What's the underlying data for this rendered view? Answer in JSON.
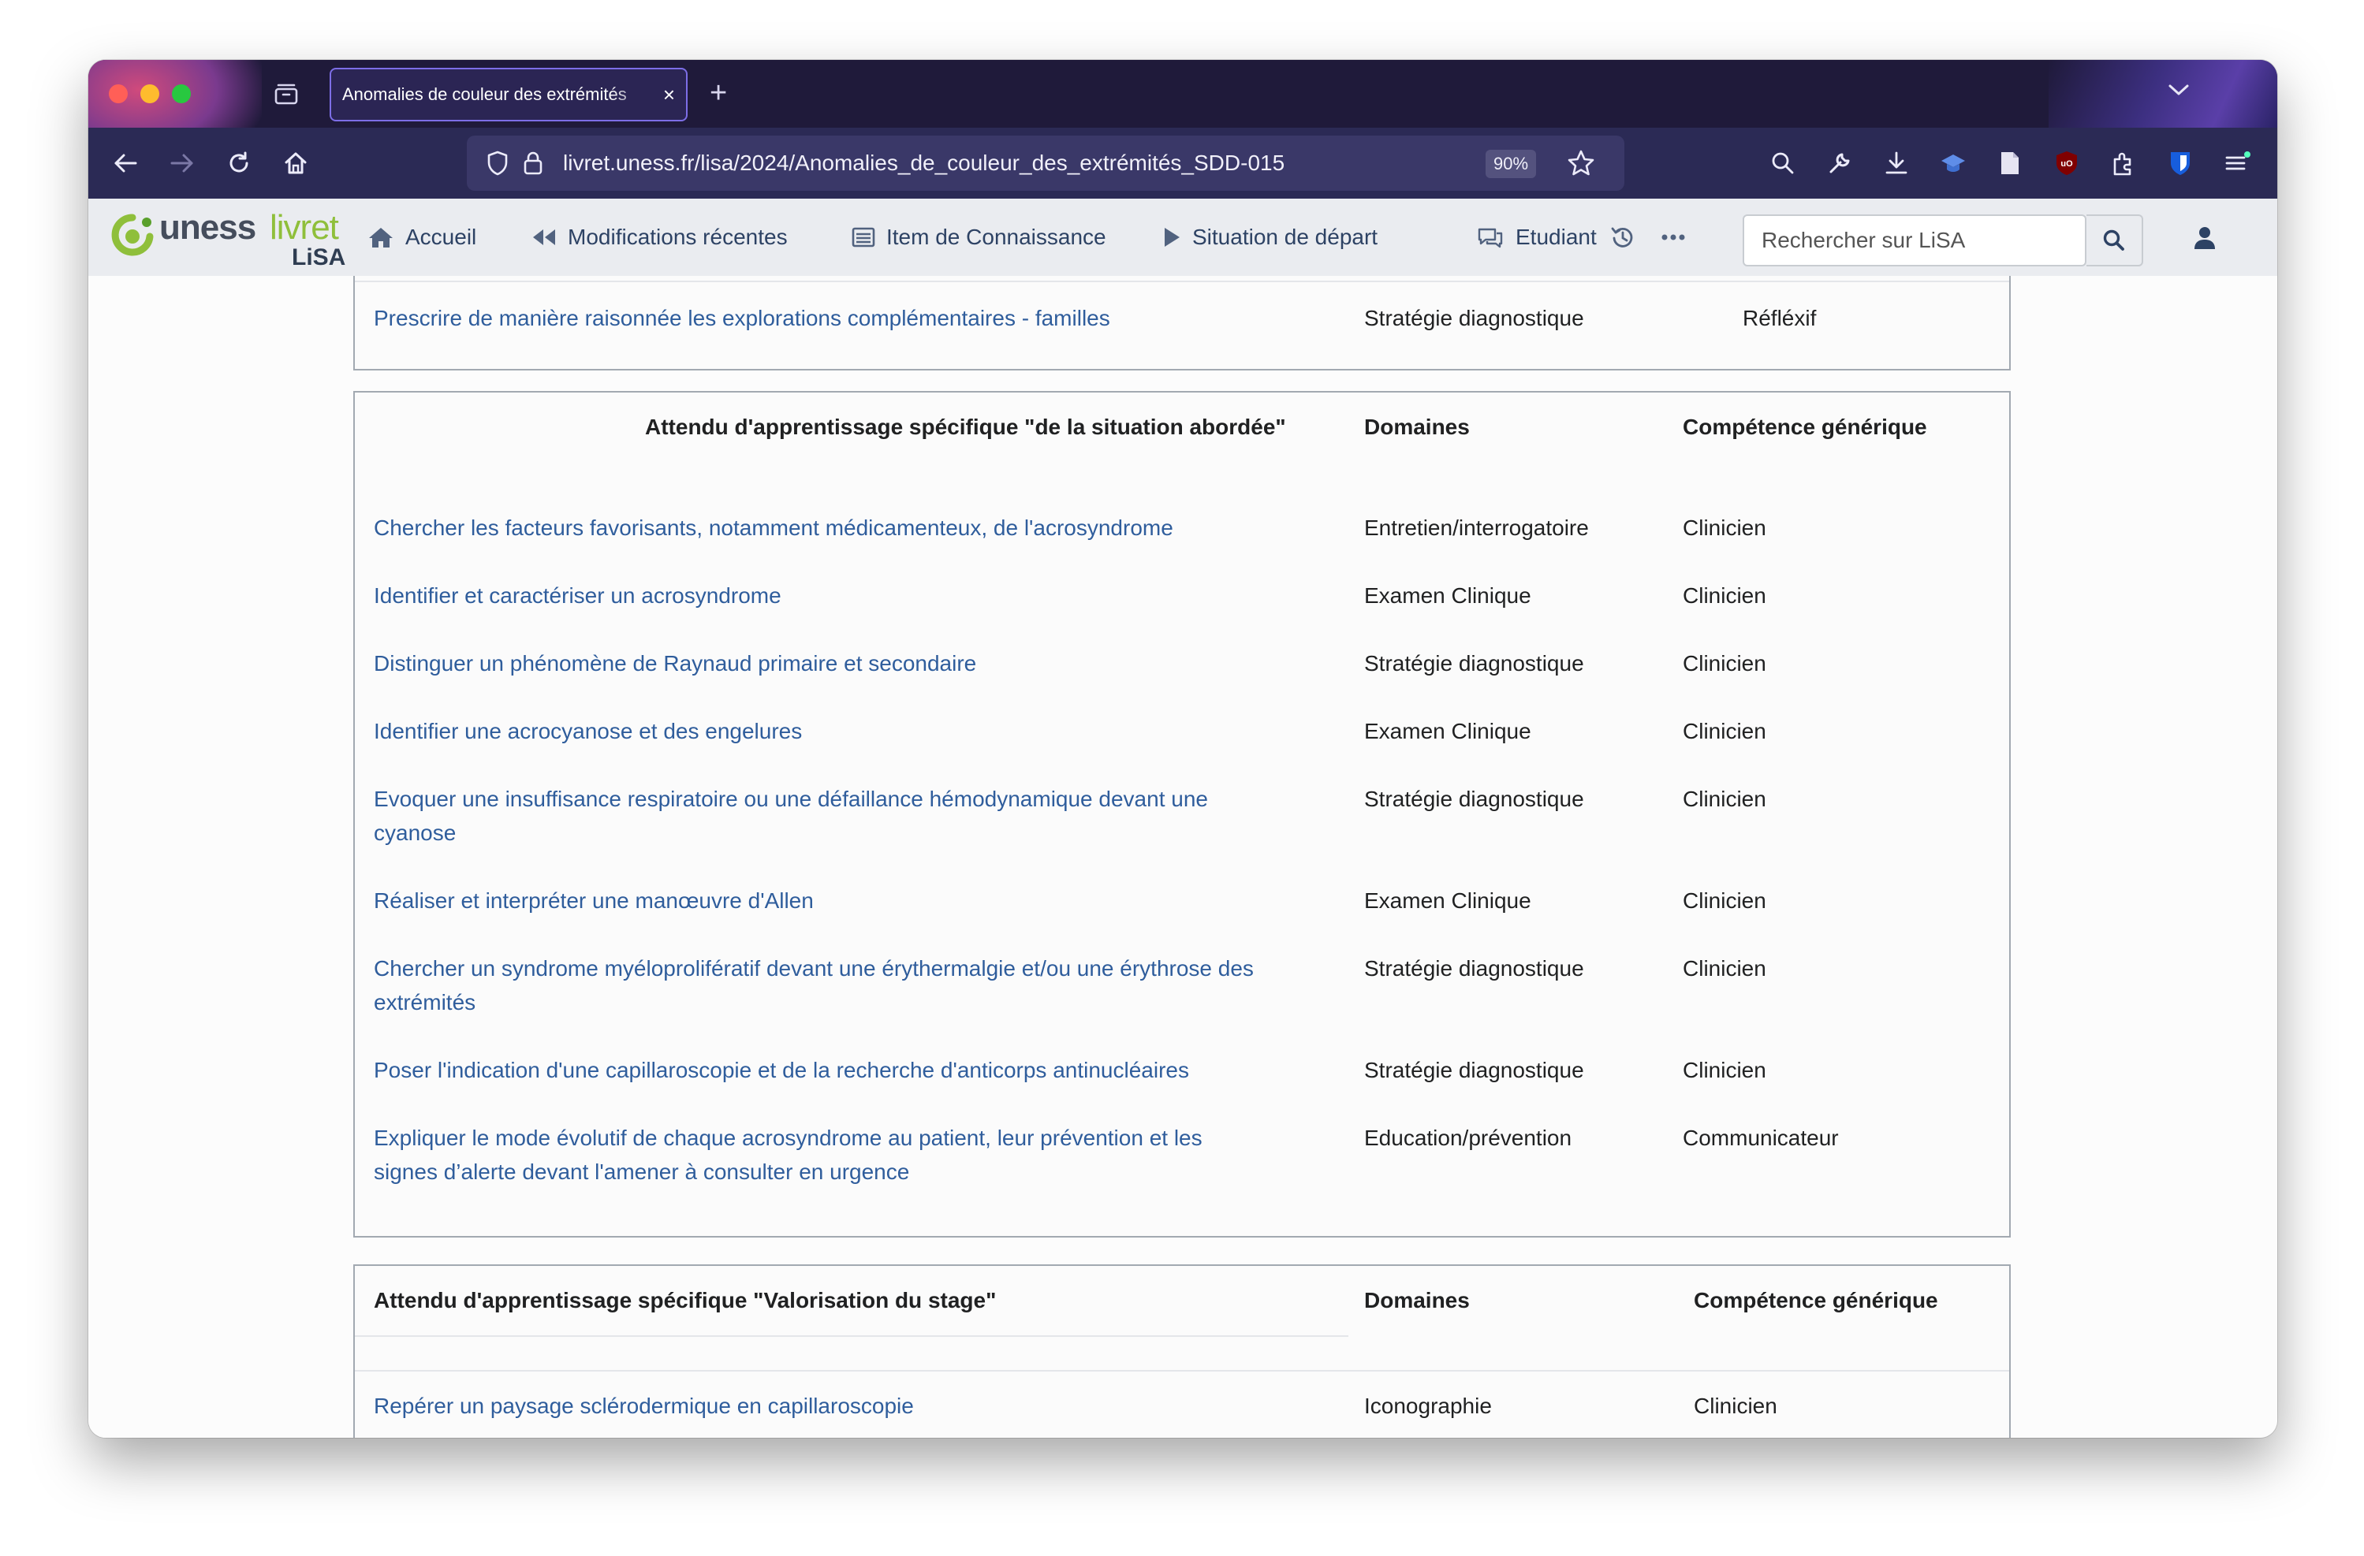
{
  "browser": {
    "tab_title": "Anomalies de couleur des extrémités",
    "url": "livret.uness.fr/lisa/2024/Anomalies_de_couleur_des_extrémités_SDD-015",
    "zoom": "90%"
  },
  "site": {
    "logo_word1": "uness",
    "logo_word2": "livret",
    "logo_sub": "LiSA",
    "nav": {
      "home": "Accueil",
      "recent": "Modifications récentes",
      "item": "Item de Connaissance",
      "situation": "Situation de départ",
      "student": "Etudiant"
    },
    "search_placeholder": "Rechercher sur LiSA"
  },
  "table1": {
    "rows": [
      {
        "text": "Prescrire de manière raisonnée les explorations complémentaires - familles",
        "domain": "Stratégie diagnostique",
        "skill": "Réfléxif"
      }
    ]
  },
  "table2": {
    "header": {
      "title": "Attendu d'apprentissage spécifique \"de la situation abordée\"",
      "domains": "Domaines",
      "skill": "Compétence générique"
    },
    "rows": [
      {
        "text1": "Chercher les facteurs favorisants, notamment médicamenteux, de l'acrosyndrome",
        "text2": "",
        "domain": "Entretien/interrogatoire",
        "skill": "Clinicien"
      },
      {
        "text1": "Identifier et caractériser un acrosyndrome",
        "text2": "",
        "domain": "Examen Clinique",
        "skill": "Clinicien"
      },
      {
        "text1": "Distinguer un phénomène de Raynaud primaire et secondaire",
        "text2": "",
        "domain": "Stratégie diagnostique",
        "skill": "Clinicien"
      },
      {
        "text1": "Identifier une acrocyanose et des engelures",
        "text2": "",
        "domain": "Examen Clinique",
        "skill": "Clinicien"
      },
      {
        "text1": "Evoquer une insuffisance respiratoire ou une défaillance hémodynamique devant une",
        "text2": "cyanose",
        "domain": "Stratégie diagnostique",
        "skill": "Clinicien"
      },
      {
        "text1": "Réaliser et interpréter une manœuvre d'Allen",
        "text2": "",
        "domain": "Examen Clinique",
        "skill": "Clinicien"
      },
      {
        "text1": "Chercher un syndrome myéloprolifératif devant une érythermalgie et/ou une érythrose des",
        "text2": "extrémités",
        "domain": "Stratégie diagnostique",
        "skill": "Clinicien"
      },
      {
        "text1": "Poser l'indication d'une capillaroscopie et de la recherche d'anticorps antinucléaires",
        "text2": "",
        "domain": "Stratégie diagnostique",
        "skill": "Clinicien"
      },
      {
        "text1": "Expliquer le mode évolutif de chaque acrosyndrome au patient, leur prévention et les",
        "text2": "signes d’alerte devant l'amener à consulter en urgence",
        "domain": "Education/prévention",
        "skill": "Communicateur"
      }
    ]
  },
  "table3": {
    "header": {
      "title": "Attendu d'apprentissage spécifique \"Valorisation du stage\"",
      "domains": "Domaines",
      "skill": "Compétence générique"
    },
    "rows": [
      {
        "text": "Repérer un paysage sclérodermique en capillaroscopie",
        "domain": "Iconographie",
        "skill": "Clinicien"
      }
    ]
  },
  "colors": {
    "tabstrip": "#1f1a3a",
    "navbar": "#2b2a55",
    "link": "#2f5d9c",
    "header_bg": "#eaecf0"
  }
}
